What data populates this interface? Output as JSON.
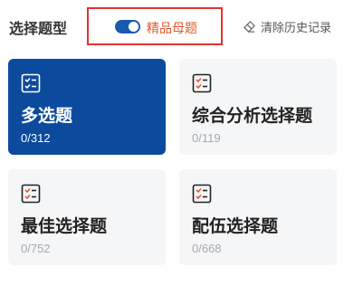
{
  "header": {
    "title": "选择题型",
    "premium_toggle": {
      "label": "精品母题",
      "on": true
    },
    "clear_history_label": "清除历史记录"
  },
  "cards": [
    {
      "name": "多选题",
      "count": "0/312",
      "active": true
    },
    {
      "name": "综合分析选择题",
      "count": "0/119",
      "active": false
    },
    {
      "name": "最佳选择题",
      "count": "0/752",
      "active": false
    },
    {
      "name": "配伍选择题",
      "count": "0/668",
      "active": false
    }
  ],
  "colors": {
    "active_card": "#0c4a9e",
    "toggle_on": "#1a5aaf",
    "premium_text": "#e2572e",
    "highlight_border": "#e3342f"
  }
}
